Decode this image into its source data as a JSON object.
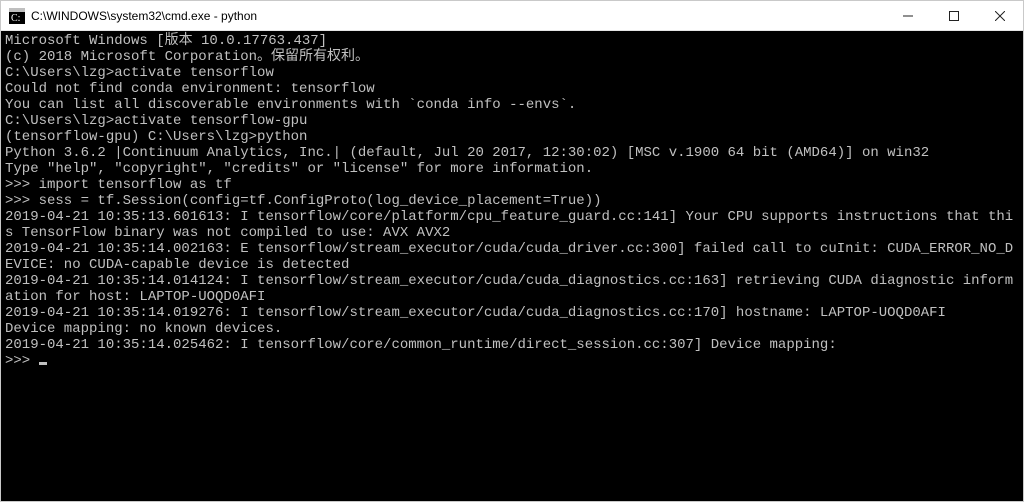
{
  "window": {
    "title": "C:\\WINDOWS\\system32\\cmd.exe - python"
  },
  "terminal": {
    "lines": [
      "Microsoft Windows [版本 10.0.17763.437]",
      "(c) 2018 Microsoft Corporation。保留所有权利。",
      "",
      "C:\\Users\\lzg>activate tensorflow",
      "Could not find conda environment: tensorflow",
      "You can list all discoverable environments with `conda info --envs`.",
      "",
      "",
      "C:\\Users\\lzg>activate tensorflow-gpu",
      "",
      "(tensorflow-gpu) C:\\Users\\lzg>python",
      "Python 3.6.2 |Continuum Analytics, Inc.| (default, Jul 20 2017, 12:30:02) [MSC v.1900 64 bit (AMD64)] on win32",
      "Type \"help\", \"copyright\", \"credits\" or \"license\" for more information.",
      ">>> import tensorflow as tf",
      ">>> sess = tf.Session(config=tf.ConfigProto(log_device_placement=True))",
      "2019-04-21 10:35:13.601613: I tensorflow/core/platform/cpu_feature_guard.cc:141] Your CPU supports instructions that this TensorFlow binary was not compiled to use: AVX AVX2",
      "2019-04-21 10:35:14.002163: E tensorflow/stream_executor/cuda/cuda_driver.cc:300] failed call to cuInit: CUDA_ERROR_NO_DEVICE: no CUDA-capable device is detected",
      "2019-04-21 10:35:14.014124: I tensorflow/stream_executor/cuda/cuda_diagnostics.cc:163] retrieving CUDA diagnostic information for host: LAPTOP-UOQD0AFI",
      "2019-04-21 10:35:14.019276: I tensorflow/stream_executor/cuda/cuda_diagnostics.cc:170] hostname: LAPTOP-UOQD0AFI",
      "Device mapping: no known devices.",
      "2019-04-21 10:35:14.025462: I tensorflow/core/common_runtime/direct_session.cc:307] Device mapping:",
      ""
    ],
    "prompt": ">>> "
  }
}
